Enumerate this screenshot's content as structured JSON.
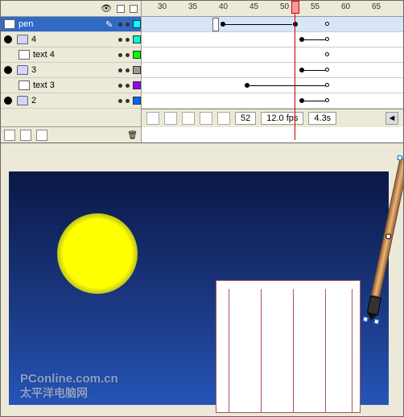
{
  "layers": {
    "items": [
      {
        "name": "pen",
        "color": "#00ffff",
        "selected": true,
        "depth": 0,
        "type": "normal"
      },
      {
        "name": "4",
        "color": "#00ffcc",
        "selected": false,
        "depth": 0,
        "type": "folder"
      },
      {
        "name": "text 4",
        "color": "#00ff00",
        "selected": false,
        "depth": 1,
        "type": "normal"
      },
      {
        "name": "3",
        "color": "#999999",
        "selected": false,
        "depth": 0,
        "type": "folder"
      },
      {
        "name": "text 3",
        "color": "#9900ff",
        "selected": false,
        "depth": 1,
        "type": "normal"
      },
      {
        "name": "2",
        "color": "#0066ff",
        "selected": false,
        "depth": 0,
        "type": "folder"
      }
    ]
  },
  "timeline": {
    "ruler_ticks": [
      "30",
      "35",
      "40",
      "45",
      "50",
      "55",
      "60",
      "65"
    ],
    "footer": {
      "current_frame": "52",
      "fps": "12.0 fps",
      "time": "4.3s"
    }
  },
  "watermark": {
    "line1": "PConline.com.cn",
    "line2": "太平洋电脑网"
  }
}
